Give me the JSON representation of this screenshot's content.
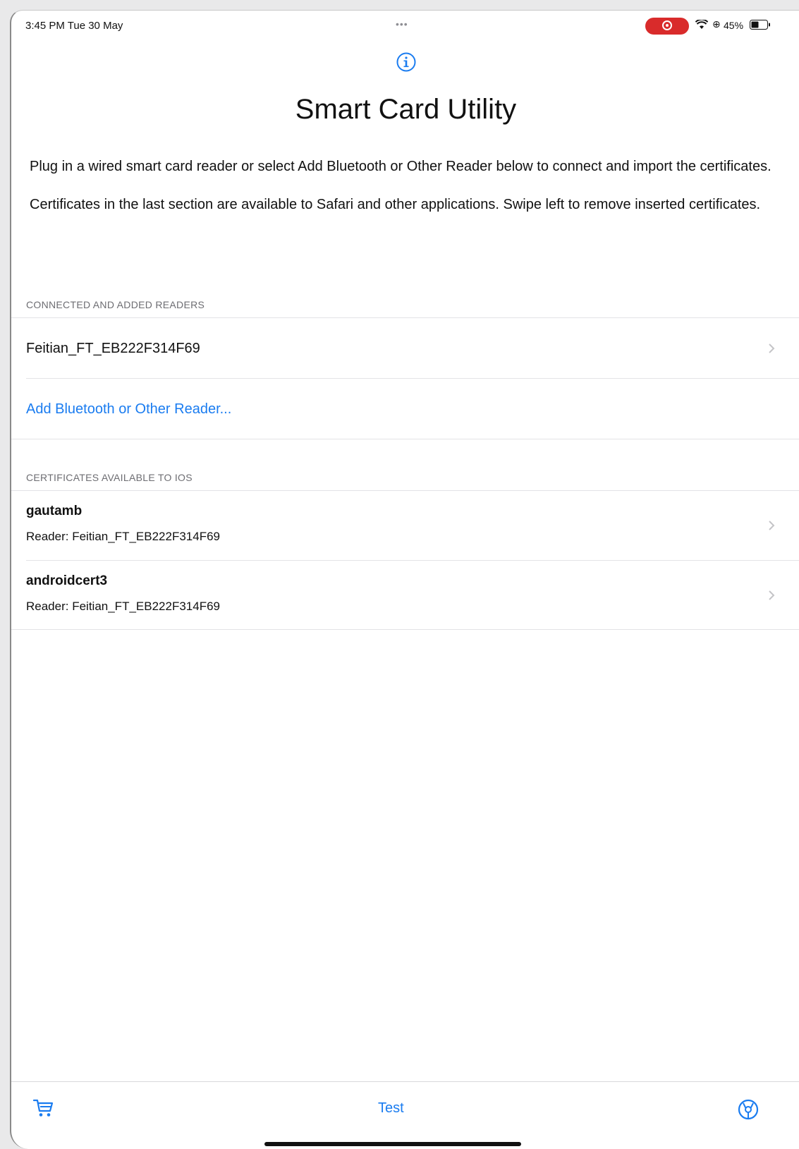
{
  "status_bar": {
    "time": "3:45 PM  Tue 30 May",
    "dots": "•••",
    "battery": "45%"
  },
  "icons": {
    "info": "info-circle-icon",
    "cart": "cart-icon",
    "settings": "settings-gear-icon",
    "chevron": "chevron-right-icon"
  },
  "header": {
    "title": "Smart Card Utility"
  },
  "description": {
    "paragraph1": "Plug in a wired smart card reader or select Add Bluetooth or Other Reader below to connect and import the certificates.",
    "paragraph2": "Certificates in the last section are available to Safari and other applications. Swipe left to remove inserted certificates."
  },
  "readers_section": {
    "header": "CONNECTED AND ADDED READERS",
    "reader_name": "Feitian_FT_EB222F314F69",
    "add_reader": "Add Bluetooth or Other Reader..."
  },
  "certificates_section": {
    "header": "CERTIFICATES AVAILABLE TO IOS",
    "items": [
      {
        "name": "gautamb",
        "reader": "Reader: Feitian_FT_EB222F314F69"
      },
      {
        "name": "androidcert3",
        "reader": "Reader: Feitian_FT_EB222F314F69"
      }
    ]
  },
  "toolbar": {
    "test_label": "Test"
  },
  "colors": {
    "accent": "#1a7cf0",
    "record": "#d92b2b",
    "section_header": "#6d6d72"
  }
}
